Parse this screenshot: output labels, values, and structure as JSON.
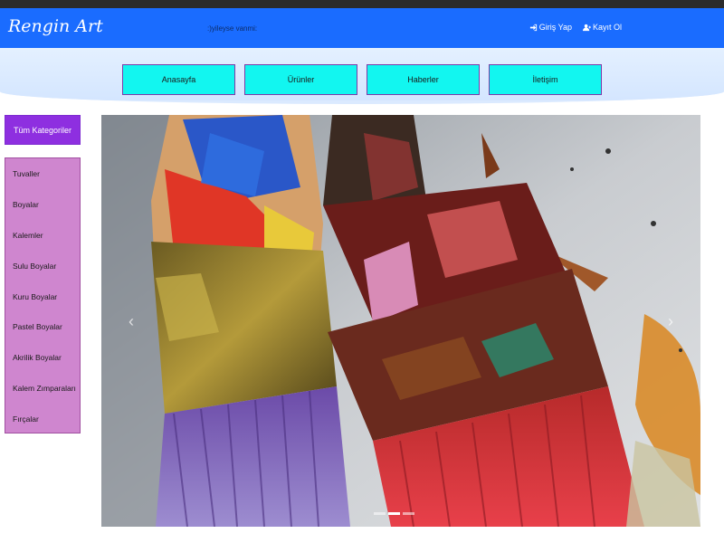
{
  "navbar": {
    "brand": "Rengin Art",
    "tagline": ":)yileyse vanmi:",
    "login_label": "Giriş Yap",
    "register_label": "Kayıt Ol"
  },
  "menu": {
    "items": [
      {
        "label": "Anasayfa"
      },
      {
        "label": "Ürünler"
      },
      {
        "label": "Haberler"
      },
      {
        "label": "İletişim"
      }
    ]
  },
  "sidebar": {
    "header": "Tüm Kategoriler",
    "items": [
      {
        "label": "Tuvaller"
      },
      {
        "label": "Boyalar"
      },
      {
        "label": "Kalemler"
      },
      {
        "label": "Sulu Boyalar"
      },
      {
        "label": "Kuru Boyalar"
      },
      {
        "label": "Pastel Boyalar"
      },
      {
        "label": "Akrilik Boyalar"
      },
      {
        "label": "Kalem Zımparaları"
      },
      {
        "label": "Fırçalar"
      }
    ]
  },
  "carousel": {
    "prev_icon": "chevron-left-icon",
    "next_icon": "chevron-right-icon",
    "slides": 3,
    "active_slide": 2
  },
  "colors": {
    "navbar": "#1a6cff",
    "menu_button": "#12f6f0",
    "category_header": "#8e2fe0",
    "category_list": "#cf86cf"
  }
}
